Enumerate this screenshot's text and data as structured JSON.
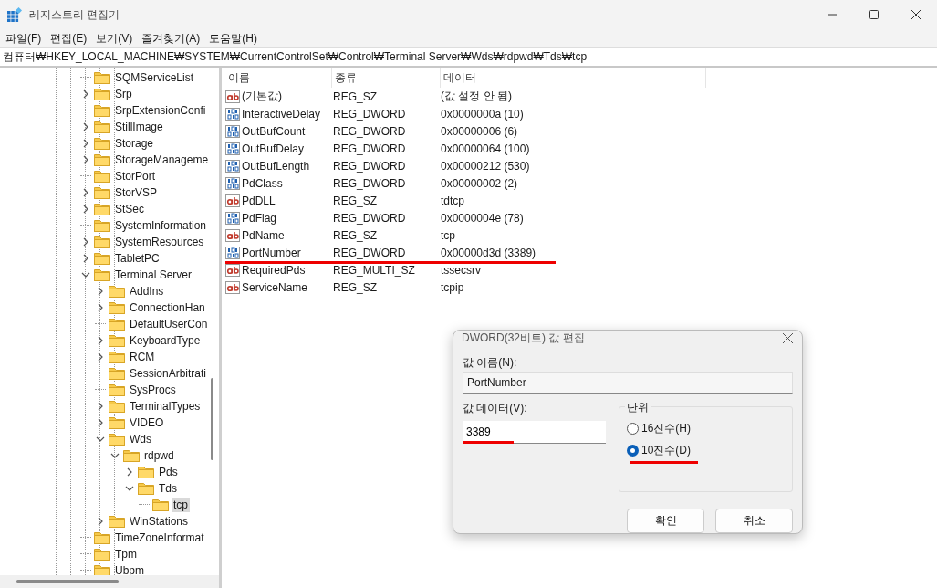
{
  "window": {
    "title": "레지스트리 편집기"
  },
  "menu": [
    "파일(F)",
    "편집(E)",
    "보기(V)",
    "즐겨찾기(A)",
    "도움말(H)"
  ],
  "address": "컴퓨터₩HKEY_LOCAL_MACHINE₩SYSTEM₩CurrentControlSet₩Control₩Terminal Server₩Wds₩rdpwd₩Tds₩tcp",
  "tree": [
    {
      "label": "SQMServiceList",
      "expandable": false,
      "selected": false
    },
    {
      "label": "Srp",
      "expandable": true,
      "expanded": false,
      "selected": false
    },
    {
      "label": "SrpExtensionConfi",
      "expandable": false,
      "selected": false
    },
    {
      "label": "StillImage",
      "expandable": true,
      "expanded": false,
      "selected": false
    },
    {
      "label": "Storage",
      "expandable": true,
      "expanded": false,
      "selected": false
    },
    {
      "label": "StorageManageme",
      "expandable": true,
      "expanded": false,
      "selected": false
    },
    {
      "label": "StorPort",
      "expandable": false,
      "selected": false
    },
    {
      "label": "StorVSP",
      "expandable": true,
      "expanded": false,
      "selected": false
    },
    {
      "label": "StSec",
      "expandable": true,
      "expanded": false,
      "selected": false
    },
    {
      "label": "SystemInformation",
      "expandable": false,
      "selected": false
    },
    {
      "label": "SystemResources",
      "expandable": true,
      "expanded": false,
      "selected": false
    },
    {
      "label": "TabletPC",
      "expandable": true,
      "expanded": false,
      "selected": false
    },
    {
      "label": "Terminal Server",
      "expandable": true,
      "expanded": true,
      "selected": false,
      "children": [
        {
          "label": "AddIns",
          "expandable": true,
          "expanded": false,
          "selected": false
        },
        {
          "label": "ConnectionHan",
          "expandable": true,
          "expanded": false,
          "selected": false
        },
        {
          "label": "DefaultUserCon",
          "expandable": false,
          "selected": false
        },
        {
          "label": "KeyboardType",
          "expandable": true,
          "expanded": false,
          "selected": false
        },
        {
          "label": "RCM",
          "expandable": true,
          "expanded": false,
          "selected": false
        },
        {
          "label": "SessionArbitrati",
          "expandable": false,
          "selected": false
        },
        {
          "label": "SysProcs",
          "expandable": false,
          "selected": false
        },
        {
          "label": "TerminalTypes",
          "expandable": true,
          "expanded": false,
          "selected": false
        },
        {
          "label": "VIDEO",
          "expandable": true,
          "expanded": false,
          "selected": false
        },
        {
          "label": "Wds",
          "expandable": true,
          "expanded": true,
          "selected": false,
          "children": [
            {
              "label": "rdpwd",
              "expandable": true,
              "expanded": true,
              "selected": false,
              "children": [
                {
                  "label": "Pds",
                  "expandable": true,
                  "expanded": false,
                  "selected": false
                },
                {
                  "label": "Tds",
                  "expandable": true,
                  "expanded": true,
                  "selected": false,
                  "children": [
                    {
                      "label": "tcp",
                      "expandable": false,
                      "selected": true
                    }
                  ]
                }
              ]
            }
          ]
        },
        {
          "label": "WinStations",
          "expandable": true,
          "expanded": false,
          "selected": false
        }
      ]
    },
    {
      "label": "TimeZoneInformat",
      "expandable": false,
      "selected": false
    },
    {
      "label": "Tpm",
      "expandable": false,
      "selected": false
    },
    {
      "label": "Ubpm",
      "expandable": false,
      "selected": false
    }
  ],
  "table": {
    "columns": [
      "이름",
      "종류",
      "데이터"
    ],
    "rows": [
      {
        "kind": "string",
        "name": "(기본값)",
        "type": "REG_SZ",
        "data": "(값 설정 안 됨)",
        "underlined": false
      },
      {
        "kind": "binary",
        "name": "InteractiveDelay",
        "type": "REG_DWORD",
        "data": "0x0000000a (10)",
        "underlined": false
      },
      {
        "kind": "binary",
        "name": "OutBufCount",
        "type": "REG_DWORD",
        "data": "0x00000006 (6)",
        "underlined": false
      },
      {
        "kind": "binary",
        "name": "OutBufDelay",
        "type": "REG_DWORD",
        "data": "0x00000064 (100)",
        "underlined": false
      },
      {
        "kind": "binary",
        "name": "OutBufLength",
        "type": "REG_DWORD",
        "data": "0x00000212 (530)",
        "underlined": false
      },
      {
        "kind": "binary",
        "name": "PdClass",
        "type": "REG_DWORD",
        "data": "0x00000002 (2)",
        "underlined": false
      },
      {
        "kind": "string",
        "name": "PdDLL",
        "type": "REG_SZ",
        "data": "tdtcp",
        "underlined": false
      },
      {
        "kind": "binary",
        "name": "PdFlag",
        "type": "REG_DWORD",
        "data": "0x0000004e (78)",
        "underlined": false
      },
      {
        "kind": "string",
        "name": "PdName",
        "type": "REG_SZ",
        "data": "tcp",
        "underlined": false
      },
      {
        "kind": "binary",
        "name": "PortNumber",
        "type": "REG_DWORD",
        "data": "0x00000d3d (3389)",
        "underlined": true
      },
      {
        "kind": "string",
        "name": "RequiredPds",
        "type": "REG_MULTI_SZ",
        "data": "tssecsrv",
        "underlined": false
      },
      {
        "kind": "string",
        "name": "ServiceName",
        "type": "REG_SZ",
        "data": "tcpip",
        "underlined": false
      }
    ]
  },
  "dialog": {
    "title": "DWORD(32비트) 값 편집",
    "name_label": "값 이름(N):",
    "name_value": "PortNumber",
    "data_label": "값 데이터(V):",
    "data_value": "3389",
    "data_underlined": true,
    "unit_label": "단위",
    "radios": [
      {
        "label": "16진수(H)",
        "selected": false,
        "underlined": false
      },
      {
        "label": "10진수(D)",
        "selected": true,
        "underlined": true
      }
    ],
    "buttons": [
      "확인",
      "취소"
    ]
  }
}
